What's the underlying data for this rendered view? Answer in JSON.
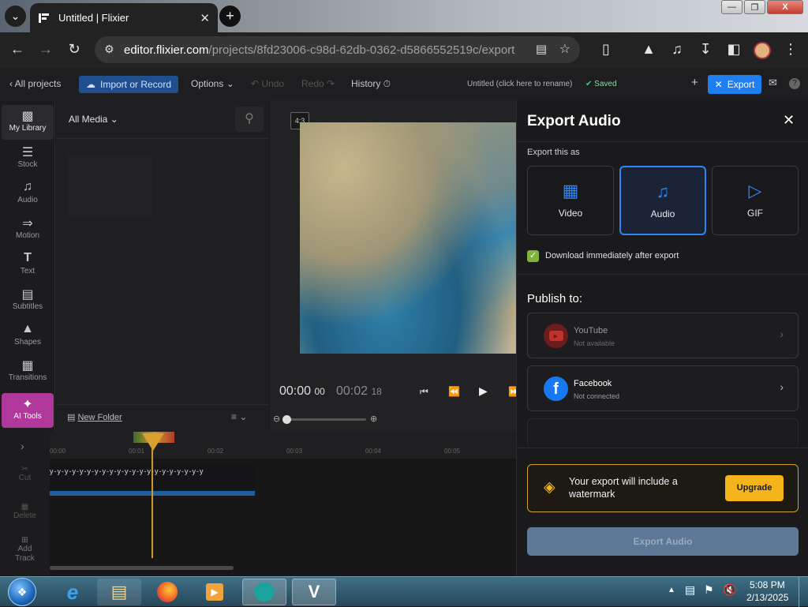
{
  "browser": {
    "tab_title": "Untitled | Flixier",
    "url_domain": "editor.flixier.com",
    "url_path": "/projects/8fd23006-c98d-62db-0362-d5866552519c/export"
  },
  "app_toolbar": {
    "all_projects": "All projects",
    "import_record": "Import or Record",
    "options": "Options",
    "undo": "Undo",
    "redo": "Redo",
    "history": "History",
    "project_name": "Untitled (click here to rename)",
    "saved": "Saved",
    "export": "Export"
  },
  "sidebar": {
    "items": [
      {
        "label": "My Library",
        "icon": "folder-icon"
      },
      {
        "label": "Stock",
        "icon": "stock-icon"
      },
      {
        "label": "Audio",
        "icon": "music-note-icon"
      },
      {
        "label": "Motion",
        "icon": "motion-icon"
      },
      {
        "label": "Text",
        "icon": "text-icon"
      },
      {
        "label": "Subtitles",
        "icon": "subtitles-icon"
      },
      {
        "label": "Shapes",
        "icon": "shapes-icon"
      },
      {
        "label": "Transitions",
        "icon": "transitions-icon"
      },
      {
        "label": "AI Tools",
        "icon": "sparkle-icon"
      }
    ]
  },
  "media": {
    "filter": "All Media",
    "new_folder": "New Folder"
  },
  "preview": {
    "aspect": "4:3",
    "time_current": "00:00",
    "frame_current": "00",
    "time_total": "00:02",
    "frame_total": "18"
  },
  "timeline": {
    "tools": [
      {
        "label": "Cut",
        "icon": "scissors-icon"
      },
      {
        "label": "Delete",
        "icon": "trash-icon"
      },
      {
        "label": "Add Track",
        "icon": "add-track-icon"
      }
    ],
    "ticks": [
      "00:00",
      "00:01",
      "00:02",
      "00:03",
      "00:04",
      "00:05"
    ]
  },
  "export_panel": {
    "title": "Export Audio",
    "section_label": "Export this as",
    "types": [
      {
        "label": "Video",
        "icon": "film-icon",
        "selected": false
      },
      {
        "label": "Audio",
        "icon": "music-note-icon",
        "selected": true
      },
      {
        "label": "GIF",
        "icon": "play-circle-icon",
        "selected": false
      }
    ],
    "download_label": "Download immediately after export",
    "download_checked": true,
    "publish_label": "Publish to:",
    "destinations": [
      {
        "name": "YouTube",
        "status": "Not available",
        "color": "#c4302b"
      },
      {
        "name": "Facebook",
        "status": "Not connected",
        "color": "#1877f2"
      }
    ],
    "watermark_text": "Your export will include a watermark",
    "upgrade": "Upgrade",
    "export_button": "Export Audio"
  },
  "taskbar": {
    "time": "5:08 PM",
    "date": "2/13/2025"
  },
  "colors": {
    "accent": "#1f7ef0",
    "upgrade": "#f4b41a",
    "saved": "#3ecf6e"
  }
}
